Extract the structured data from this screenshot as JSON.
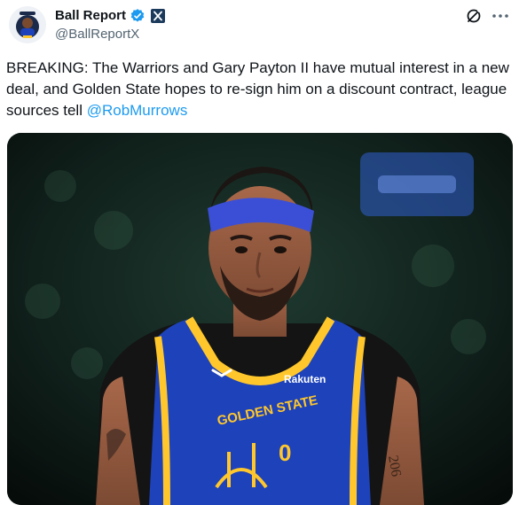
{
  "tweet": {
    "display_name": "Ball Report",
    "handle": "@BallReportX",
    "text_main": "BREAKING: The Warriors and Gary Payton II have mutual interest in a new deal, and Golden State hopes to re-sign him on a discount contract, league sources tell ",
    "mention": "@RobMurrows"
  },
  "media": {
    "jersey_brand": "Rakuten",
    "jersey_team": "GOLDEN STATE",
    "jersey_number": "0",
    "tattoo_text": "206"
  },
  "colors": {
    "accent": "#1d9bf0",
    "verified": "#1d9bf0",
    "jersey_blue": "#1d42ba",
    "jersey_yellow": "#ffc72c"
  },
  "icons": {
    "verified": "verified-badge-icon",
    "affiliate": "x-affiliate-icon",
    "grok": "grok-icon",
    "more": "more-dots-icon"
  }
}
